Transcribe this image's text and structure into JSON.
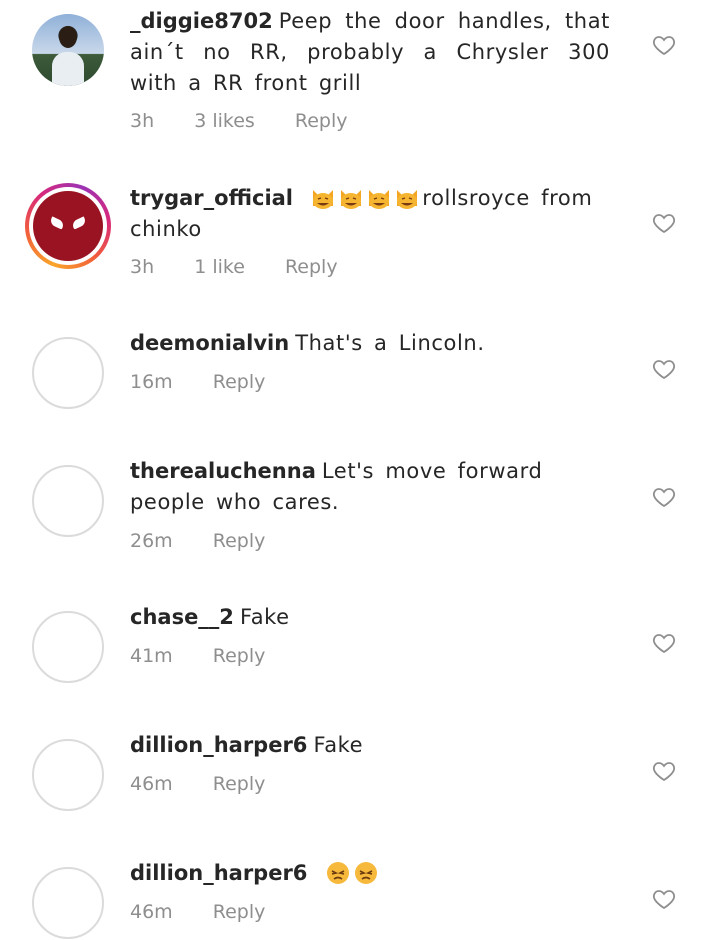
{
  "comments": [
    {
      "username": "_diggie8702",
      "text": "Peep the door handles, that ain´t no RR, probably a Chrysler 300 with a RR front grill",
      "time": "3h",
      "likes": "3 likes",
      "reply": "Reply",
      "avatar": "photo-icon"
    },
    {
      "username": "trygar_official",
      "emoji": "grinning-cat-icon",
      "emoji_count": 4,
      "text": "rollsroyce from chinko",
      "time": "3h",
      "likes": "1 like",
      "reply": "Reply",
      "avatar": "story-ring-icon"
    },
    {
      "username": "deemonialvin",
      "text": "That's a Lincoln.",
      "time": "16m",
      "reply": "Reply",
      "avatar": "empty"
    },
    {
      "username": "therealuchenna",
      "text": "Let's move forward people who cares.",
      "time": "26m",
      "reply": "Reply",
      "avatar": "empty"
    },
    {
      "username": "chase__2",
      "text": "Fake",
      "time": "41m",
      "reply": "Reply",
      "avatar": "empty"
    },
    {
      "username": "dillion_harper6",
      "text": "Fake",
      "time": "46m",
      "reply": "Reply",
      "avatar": "empty"
    },
    {
      "username": "dillion_harper6",
      "emoji": "persevering-face-icon",
      "emoji_count": 2,
      "text": "",
      "time": "46m",
      "reply": "Reply",
      "avatar": "empty"
    }
  ],
  "colors": {
    "text": "#262626",
    "meta": "#8e8e8e",
    "heart": "#8e8e8e",
    "emoji": "#f4b400"
  }
}
